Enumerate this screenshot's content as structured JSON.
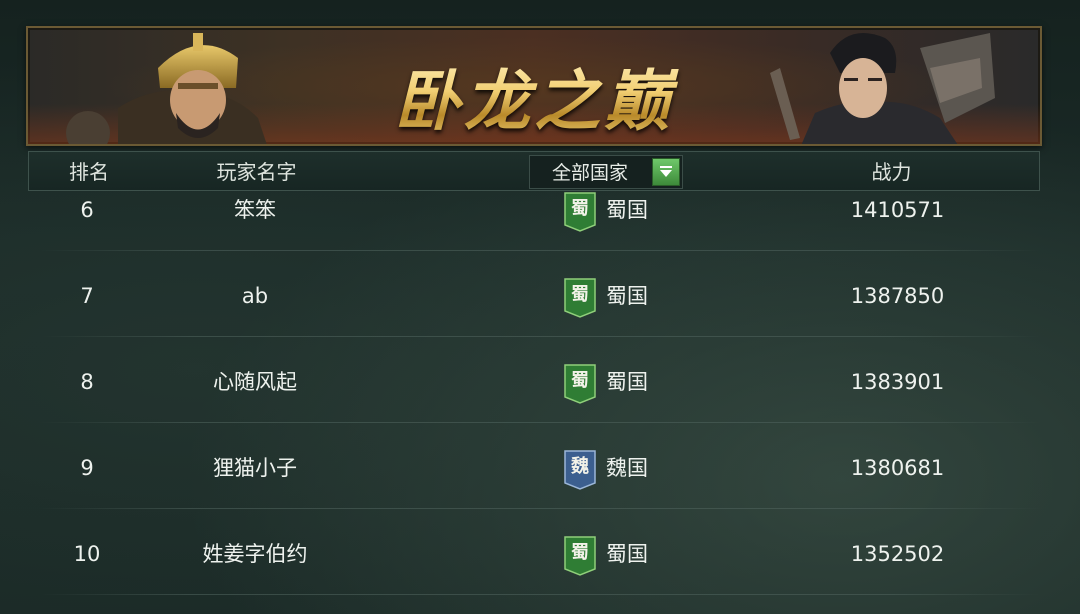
{
  "banner": {
    "title": "卧龙之巅"
  },
  "header": {
    "rank_label": "排名",
    "name_label": "玩家名字",
    "country_filter": {
      "selected": "全部国家"
    },
    "power_label": "战力"
  },
  "colors": {
    "shu_badge": "#2f7d34",
    "wei_badge": "#3c5f8f",
    "filter_button": "#4fa84a",
    "title_gold": "#f2cf73"
  },
  "rows": [
    {
      "rank": "6",
      "name": "笨笨",
      "badge": "蜀",
      "country": "蜀国",
      "faction": "shu",
      "power": "1410571"
    },
    {
      "rank": "7",
      "name": "ab",
      "badge": "蜀",
      "country": "蜀国",
      "faction": "shu",
      "power": "1387850"
    },
    {
      "rank": "8",
      "name": "心随风起",
      "badge": "蜀",
      "country": "蜀国",
      "faction": "shu",
      "power": "1383901"
    },
    {
      "rank": "9",
      "name": "狸猫小子",
      "badge": "魏",
      "country": "魏国",
      "faction": "wei",
      "power": "1380681"
    },
    {
      "rank": "10",
      "name": "姓姜字伯约",
      "badge": "蜀",
      "country": "蜀国",
      "faction": "shu",
      "power": "1352502"
    }
  ]
}
